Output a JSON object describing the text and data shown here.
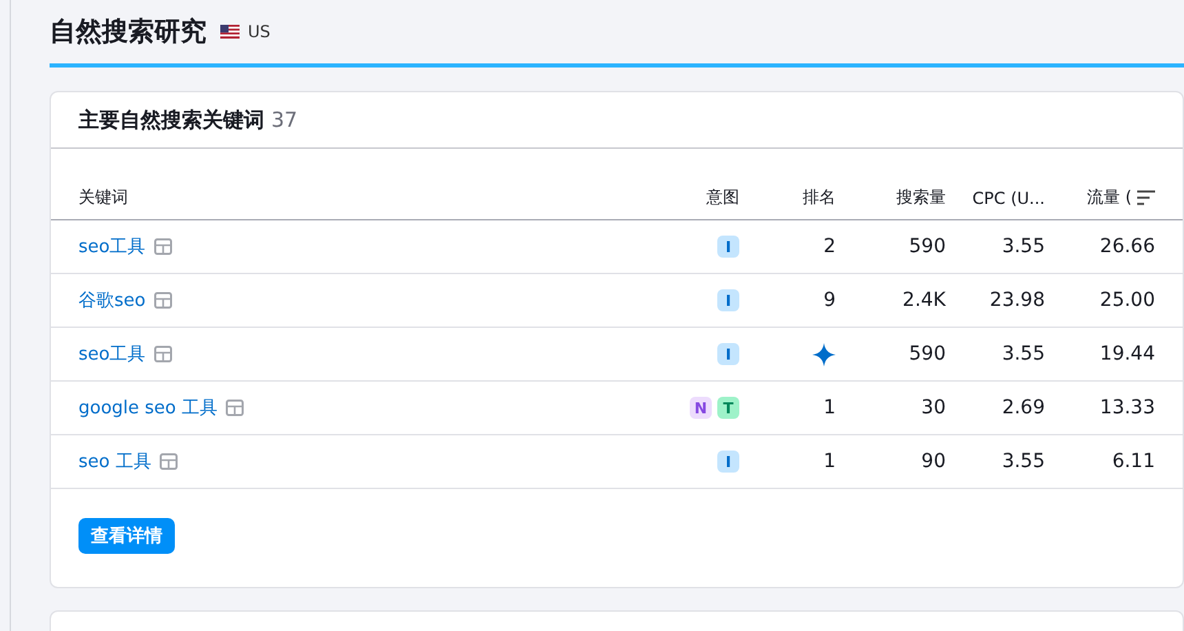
{
  "page": {
    "title": "自然搜索研究",
    "region": "US"
  },
  "card": {
    "title": "主要自然搜索关键词",
    "count": "37",
    "columns": [
      "关键词",
      "意图",
      "排名",
      "搜索量",
      "CPC (U...",
      "流量 ("
    ],
    "rows": [
      {
        "keyword": "seo工具",
        "intents": [
          {
            "letter": "I",
            "color": "#c4e5fe"
          }
        ],
        "rank": {
          "kind": "number",
          "text": "2"
        },
        "volume": "590",
        "cpc": "3.55",
        "traffic": "26.66"
      },
      {
        "keyword": "谷歌seo",
        "intents": [
          {
            "letter": "I",
            "color": "#c4e5fe"
          }
        ],
        "rank": {
          "kind": "number",
          "text": "9"
        },
        "volume": "2.4K",
        "cpc": "23.98",
        "traffic": "25.00"
      },
      {
        "keyword": "seo工具",
        "intents": [
          {
            "letter": "I",
            "color": "#c4e5fe"
          }
        ],
        "rank": {
          "kind": "feature"
        },
        "volume": "590",
        "cpc": "3.55",
        "traffic": "19.44"
      },
      {
        "keyword": "google seo 工具",
        "intents": [
          {
            "letter": "N",
            "color": "#eddcfd"
          },
          {
            "letter": "T",
            "color": "#9ef2c9"
          }
        ],
        "rank": {
          "kind": "number",
          "text": "1"
        },
        "volume": "30",
        "cpc": "2.69",
        "traffic": "13.33"
      },
      {
        "keyword": "seo 工具",
        "intents": [
          {
            "letter": "I",
            "color": "#c4e5fe"
          }
        ],
        "rank": {
          "kind": "number",
          "text": "1"
        },
        "volume": "90",
        "cpc": "3.55",
        "traffic": "6.11"
      }
    ],
    "button": "查看详情"
  }
}
